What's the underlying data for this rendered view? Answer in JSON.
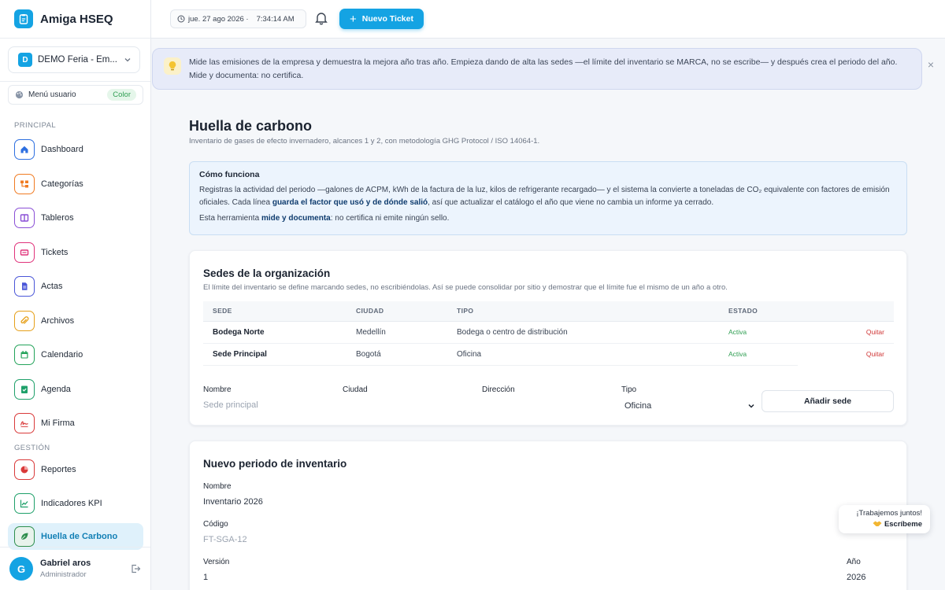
{
  "brand": {
    "name": "Amiga HSEQ"
  },
  "org": {
    "badge": "D",
    "name": "DEMO Feria - Em..."
  },
  "menu_user": {
    "label": "Menú usuario",
    "color_badge": "Color"
  },
  "sections": {
    "principal": "PRINCIPAL",
    "gestion": "GESTIÓN"
  },
  "nav": [
    {
      "label": "Dashboard",
      "icon": "home-icon",
      "color": "#2d6fe0"
    },
    {
      "label": "Categorías",
      "icon": "sitemap-icon",
      "color": "#f07b22"
    },
    {
      "label": "Tableros",
      "icon": "columns-icon",
      "color": "#8a4fd6"
    },
    {
      "label": "Tickets",
      "icon": "ticket-icon",
      "color": "#e0337b"
    },
    {
      "label": "Actas",
      "icon": "document-icon",
      "color": "#4a56d8"
    },
    {
      "label": "Archivos",
      "icon": "paperclip-icon",
      "color": "#e6a01a"
    },
    {
      "label": "Calendario",
      "icon": "calendar-icon",
      "color": "#23a35a"
    },
    {
      "label": "Agenda",
      "icon": "checklist-icon",
      "color": "#1fa06a"
    },
    {
      "label": "Mi Firma",
      "icon": "signature-icon",
      "color": "#d93a3a"
    },
    {
      "label": "Reportes",
      "icon": "pie-chart-icon",
      "color": "#d93a3a"
    },
    {
      "label": "Indicadores KPI",
      "icon": "line-chart-icon",
      "color": "#1fa06a"
    },
    {
      "label": "Huella de Carbono",
      "icon": "leaf-icon",
      "color": "#2f8f4e"
    }
  ],
  "user": {
    "initial": "G",
    "name": "Gabriel aros",
    "role": "Administrador"
  },
  "topbar": {
    "date": "jue. 27 ago 2026 ·",
    "time": "7:34:14 AM",
    "new_ticket": "Nuevo Ticket"
  },
  "banner": {
    "text": "Mide las emisiones de la empresa y demuestra la mejora año tras año. Empieza dando de alta las sedes —el límite del inventario se MARCA, no se escribe— y después crea el periodo del año. Mide y documenta: no certifica.",
    "close": "×"
  },
  "page": {
    "title": "Huella de carbono",
    "subtitle": "Inventario de gases de efecto invernadero, alcances 1 y 2, con metodología GHG Protocol / ISO 14064-1."
  },
  "info": {
    "title": "Cómo funciona",
    "p1_a": "Registras la actividad del periodo —galones de ACPM, kWh de la factura de la luz, kilos de refrigerante recargado— y el sistema la convierte a toneladas de CO₂ equivalente con factores de emisión oficiales. Cada línea ",
    "p1_b": "guarda el factor que usó y de dónde salió",
    "p1_c": ", así que actualizar el catálogo el año que viene no cambia un informe ya cerrado.",
    "p2_a": "Esta herramienta ",
    "p2_b": "mide y documenta",
    "p2_c": ": no certifica ni emite ningún sello."
  },
  "sedes": {
    "title": "Sedes de la organización",
    "subtitle": "El límite del inventario se define marcando sedes, no escribiéndolas. Así se puede consolidar por sitio y demostrar que el límite fue el mismo de un año a otro.",
    "columns": [
      "SEDE",
      "CIUDAD",
      "TIPO",
      "ESTADO"
    ],
    "rows": [
      {
        "sede": "Bodega Norte",
        "ciudad": "Medellín",
        "tipo": "Bodega o centro de distribución",
        "estado": "Activa",
        "accion": "Quitar"
      },
      {
        "sede": "Sede Principal",
        "ciudad": "Bogotá",
        "tipo": "Oficina",
        "estado": "Activa",
        "accion": "Quitar"
      }
    ],
    "form": {
      "nombre_label": "Nombre",
      "nombre_placeholder": "Sede principal",
      "ciudad_label": "Ciudad",
      "direccion_label": "Dirección",
      "tipo_label": "Tipo",
      "tipo_value": "Oficina",
      "add_button": "Añadir sede"
    }
  },
  "periodo": {
    "title": "Nuevo periodo de inventario",
    "nombre_label": "Nombre",
    "nombre_value": "Inventario 2026",
    "codigo_label": "Código",
    "codigo_placeholder": "FT-SGA-12",
    "version_label": "Versión",
    "version_value": "1",
    "anio_label": "Año",
    "anio_value": "2026"
  },
  "chat": {
    "line1": "¡Trabajemos juntos!",
    "line2": "Escríbeme"
  }
}
